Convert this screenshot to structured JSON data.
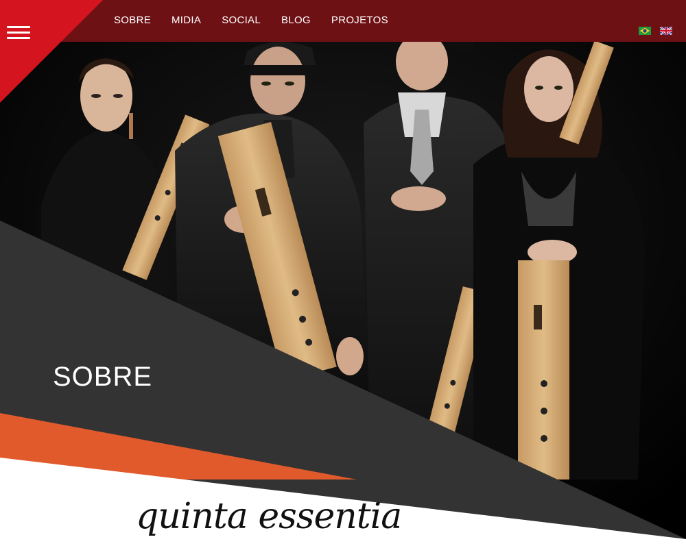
{
  "nav": {
    "items": [
      {
        "label": "SOBRE"
      },
      {
        "label": "MIDIA"
      },
      {
        "label": "SOCIAL"
      },
      {
        "label": "BLOG"
      },
      {
        "label": "PROJETOS"
      }
    ]
  },
  "languages": [
    {
      "icon": "brazil-flag-icon"
    },
    {
      "icon": "uk-flag-icon"
    }
  ],
  "hero": {
    "section_title": "SOBRE"
  },
  "logo": {
    "text": "quinta essentia"
  },
  "colors": {
    "topbar": "#6e1115",
    "corner_red": "#d4141e",
    "dark_band": "#333333",
    "orange_band": "#e05a2c",
    "white": "#ffffff"
  }
}
